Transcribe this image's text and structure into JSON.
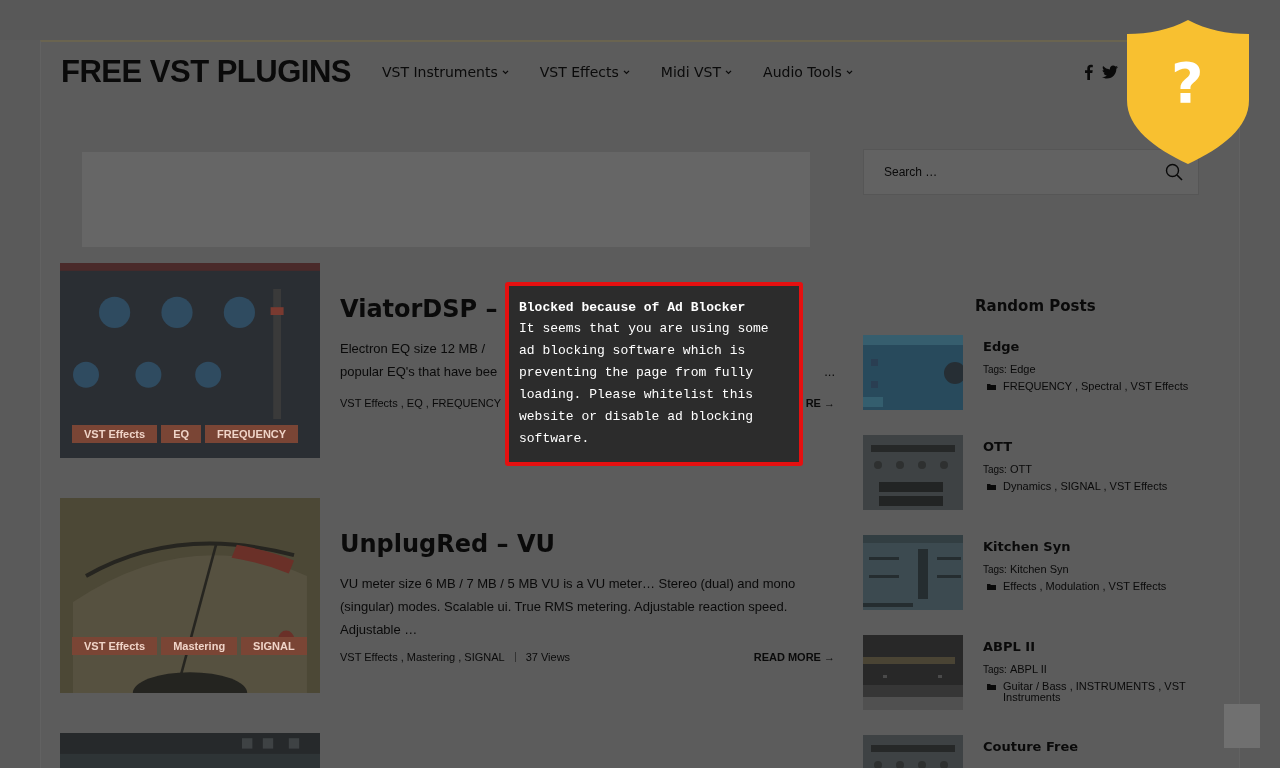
{
  "site": {
    "logo": "FREE VST PLUGINS",
    "nav": [
      {
        "label": "VST Instruments"
      },
      {
        "label": "VST Effects"
      },
      {
        "label": "Midi VST"
      },
      {
        "label": "Audio Tools"
      }
    ]
  },
  "posts": [
    {
      "kind": "picture",
      "title": "ViatorDSP –",
      "tags": [
        "VST Effects",
        "EQ",
        "FREQUENCY"
      ],
      "excerpt_parts": [
        "Electron EQ size 12 MB  /",
        "popular EQ's that have bee"
      ],
      "excerpt_end": "...",
      "categories": "VST Effects , EQ , FREQUENCY",
      "read_more": "RE →"
    },
    {
      "kind": "picture",
      "title": "UnplugRed – VU",
      "tags": [
        "VST Effects",
        "Mastering",
        "SIGNAL"
      ],
      "excerpt": "VU meter size 6 MB  / 7 MB  / 5 MB  VU is a VU meter… Stereo (dual) and mono (singular) modes. Scalable ui. True RMS metering. Adjustable reaction speed. Adjustable …",
      "categories": "VST Effects , Mastering , SIGNAL",
      "views": "37 Views",
      "read_more": "READ MORE →"
    },
    {
      "kind": "picture"
    }
  ],
  "sidebar": {
    "search": {
      "placeholder": "Search …"
    },
    "heading": "Random Posts",
    "posts": [
      {
        "title": "Edge",
        "tags_label": "Tags:",
        "tags": "Edge",
        "categories": "FREQUENCY , Spectral , VST Effects"
      },
      {
        "title": "OTT",
        "tags_label": "Tags:",
        "tags": "OTT",
        "categories": "Dynamics , SIGNAL , VST Effects"
      },
      {
        "title": "Kitchen Syn",
        "tags_label": "Tags:",
        "tags": "Kitchen Syn",
        "categories": "Effects , Modulation , VST Effects"
      },
      {
        "title": "ABPL II",
        "tags_label": "Tags:",
        "tags": "ABPL II",
        "categories": "Guitar / Bass , INSTRUMENTS , VST Instruments"
      },
      {
        "title": "Couture Free"
      }
    ]
  },
  "notice": {
    "title": "Blocked because of Ad Blocker",
    "message": "It seems that you are using some ad blocking software which is preventing the page from fully loading. Please whitelist this website or disable ad blocking software."
  },
  "badge": {
    "symbol": "?"
  }
}
